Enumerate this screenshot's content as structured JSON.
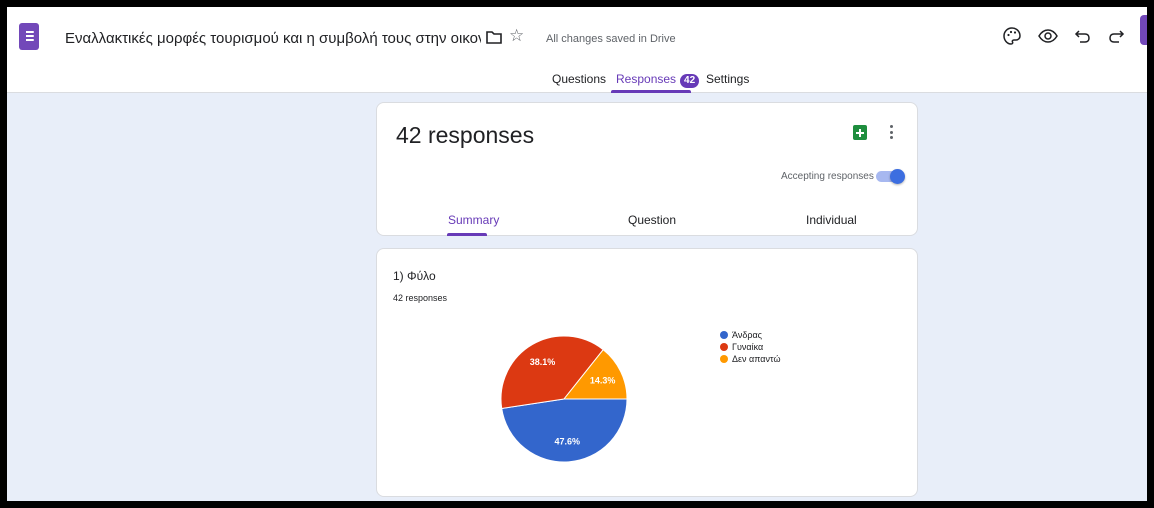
{
  "header": {
    "doc_title": "Εναλλακτικές μορφές τουρισμού και η συμβολή τους στην οικονομική ανά",
    "save_status": "All changes saved in Drive",
    "icons": [
      "forms-logo-icon",
      "folder-icon",
      "star-icon",
      "palette-icon",
      "preview-icon",
      "undo-icon",
      "redo-icon"
    ]
  },
  "tabs": {
    "questions": "Questions",
    "responses": "Responses",
    "responses_badge": "42",
    "settings": "Settings",
    "active": "responses"
  },
  "summary": {
    "count_text": "42 responses",
    "accepting_label": "Accepting responses",
    "accepting_on": true,
    "subtabs": [
      "Summary",
      "Question",
      "Individual"
    ],
    "active_subtab": "Summary"
  },
  "question": {
    "title": "1) Φύλο",
    "count": "42 responses"
  },
  "chart_data": {
    "type": "pie",
    "categories": [
      "Άνδρας",
      "Γυναίκα",
      "Δεν απαντώ"
    ],
    "values": [
      47.6,
      38.1,
      14.3
    ],
    "labels": [
      "47.6%",
      "38.1%",
      "14.3%"
    ],
    "colors": [
      "#3366cc",
      "#dc3912",
      "#ff9900"
    ],
    "legend_position": "right"
  },
  "colors": {
    "accent": "#673ab7",
    "background": "#e8eef9"
  }
}
